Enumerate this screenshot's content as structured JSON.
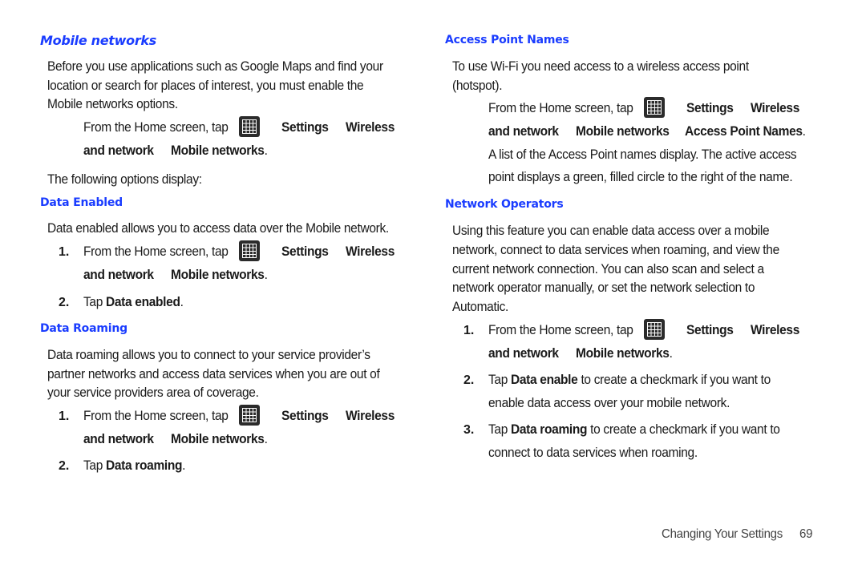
{
  "accent_color": "#1a3cff",
  "left": {
    "mobile_networks": {
      "heading": "Mobile networks",
      "intro": [
        "Before you use applications such as Google Maps and find your",
        "location or search for places of interest, you must enable the",
        "Mobile networks options."
      ],
      "step": {
        "prefix": "From the Home screen, tap",
        "settings": "Settings",
        "wireless": "Wireless",
        "and_network": "and network",
        "mobile_networks": "Mobile networks",
        "period": "."
      },
      "following": "The following options display:"
    },
    "data_enabled": {
      "heading": "Data Enabled",
      "intro": "Data enabled allows you to access data over the Mobile network.",
      "steps": [
        {
          "num": "1.",
          "prefix": "From the Home screen, tap",
          "settings": "Settings",
          "wireless": "Wireless",
          "and_network": "and network",
          "mobile_networks": "Mobile networks",
          "period": "."
        },
        {
          "num": "2.",
          "tap": "Tap",
          "bold": "Data enabled",
          "period": "."
        }
      ]
    },
    "data_roaming": {
      "heading": "Data Roaming",
      "intro": [
        "Data roaming allows you to connect to your service provider’s",
        "partner networks and access data services when you are out of",
        "your service providers area of coverage."
      ],
      "steps": [
        {
          "num": "1.",
          "prefix": "From the Home screen, tap",
          "settings": "Settings",
          "wireless": "Wireless",
          "and_network": "and network",
          "mobile_networks": "Mobile networks",
          "period": "."
        },
        {
          "num": "2.",
          "tap": "Tap",
          "bold": "Data roaming",
          "period": "."
        }
      ]
    }
  },
  "right": {
    "access_point_names": {
      "heading": "Access Point Names",
      "intro": [
        "To use Wi-Fi you need access to a wireless access point",
        "(hotspot)."
      ],
      "step": {
        "prefix": "From the Home screen, tap",
        "settings": "Settings",
        "wireless": "Wireless",
        "and_network": "and network",
        "mobile_networks": "Mobile networks",
        "apn": "Access Point Names",
        "period": "."
      },
      "result": [
        "A list of the Access Point names display. The active access",
        "point displays a green, filled circle to the right of the name."
      ]
    },
    "network_operators": {
      "heading": "Network Operators",
      "intro": [
        "Using this feature you can enable data access over a mobile",
        "network, connect to data services when roaming, and view the",
        "current network connection. You can also scan and select a",
        "network operator manually, or set the network selection to",
        "Automatic."
      ],
      "steps": [
        {
          "num": "1.",
          "prefix": "From the Home screen, tap",
          "settings": "Settings",
          "wireless": "Wireless",
          "and_network": "and network",
          "mobile_networks": "Mobile networks",
          "period": "."
        },
        {
          "num": "2.",
          "tap": "Tap",
          "bold": "Data enable",
          "rest": " to create a checkmark if you want to",
          "line2": "enable data access over your mobile network."
        },
        {
          "num": "3.",
          "tap": "Tap",
          "bold": "Data roaming",
          "rest": " to create a checkmark if you want to",
          "line2": "connect to data services when roaming."
        }
      ]
    }
  },
  "footer": {
    "section": "Changing Your Settings",
    "page": "69"
  },
  "icons": {
    "apps": "apps-grid-icon"
  }
}
